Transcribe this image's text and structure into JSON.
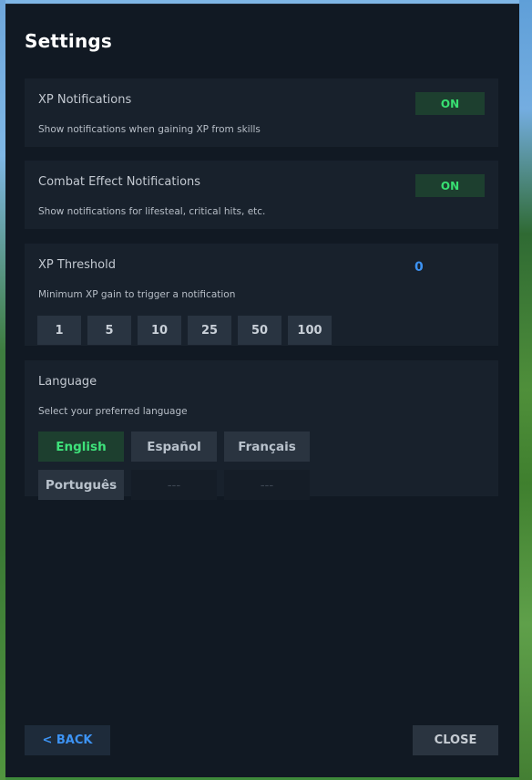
{
  "settings": {
    "title": "Settings",
    "xp_notifications": {
      "label": "XP Notifications",
      "description": "Show notifications when gaining XP from skills",
      "toggle": "ON"
    },
    "combat_notifications": {
      "label": "Combat Effect Notifications",
      "description": "Show notifications for lifesteal, critical hits, etc.",
      "toggle": "ON"
    },
    "xp_threshold": {
      "label": "XP Threshold",
      "value": "0",
      "description": "Minimum XP gain to trigger a notification",
      "presets": [
        "1",
        "5",
        "10",
        "25",
        "50",
        "100"
      ]
    },
    "language": {
      "label": "Language",
      "description": "Select your preferred language",
      "options": [
        "English",
        "Español",
        "Français",
        "Português",
        "---",
        "---"
      ],
      "selected": "English"
    },
    "footer": {
      "back_label": "< BACK",
      "close_label": "CLOSE"
    }
  },
  "colors": {
    "panel": "#111923",
    "card": "#18212c",
    "toggle_on_bg": "#1d3f2f",
    "toggle_on_text": "#38e072",
    "accent_blue": "#3d93f3"
  }
}
